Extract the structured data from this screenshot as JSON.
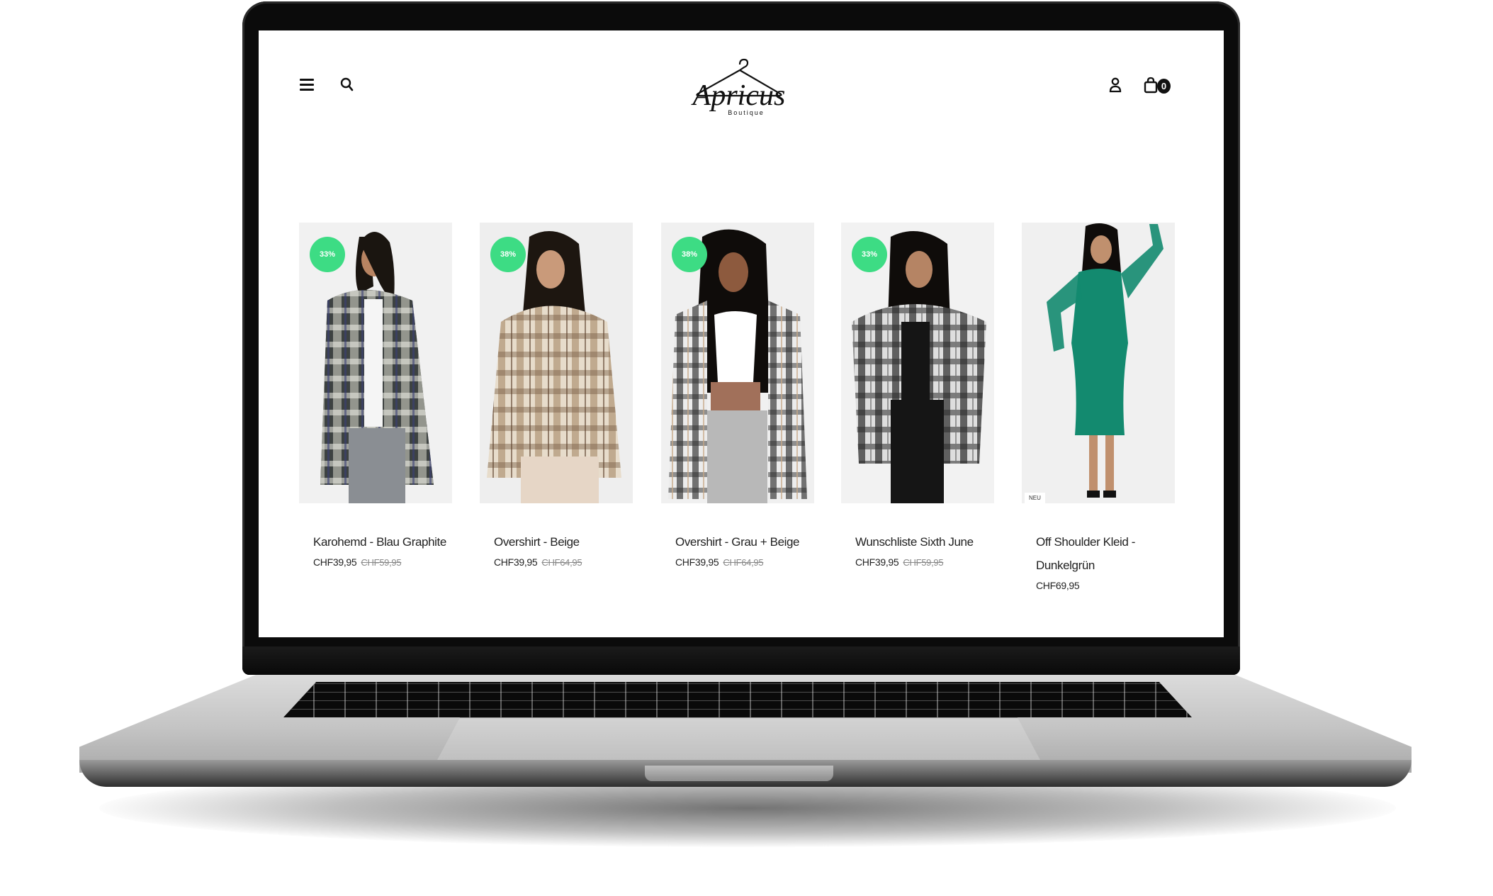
{
  "site": {
    "logo_text": "Apricus",
    "logo_subtext": "Boutique",
    "cart_count": "0"
  },
  "icons": {
    "menu": "hamburger-icon",
    "search": "search-icon",
    "user": "user-icon",
    "cart": "shopping-bag-icon"
  },
  "colors": {
    "badge": "#3ddc84",
    "dress": "#138a6f"
  },
  "products": [
    {
      "name": "Karohemd - Blau Graphite",
      "price": "CHF39,95",
      "old_price": "CHF59,95",
      "badge": "33%"
    },
    {
      "name": "Overshirt - Beige",
      "price": "CHF39,95",
      "old_price": "CHF64,95",
      "badge": "38%"
    },
    {
      "name": "Overshirt - Grau + Beige",
      "price": "CHF39,95",
      "old_price": "CHF64,95",
      "badge": "38%"
    },
    {
      "name": "Wunschliste Sixth June",
      "price": "CHF39,95",
      "old_price": "CHF59,95",
      "badge": "33%"
    },
    {
      "name": "Off Shoulder Kleid - Dunkelgrün",
      "price": "CHF69,95",
      "tag": "NEU"
    }
  ]
}
